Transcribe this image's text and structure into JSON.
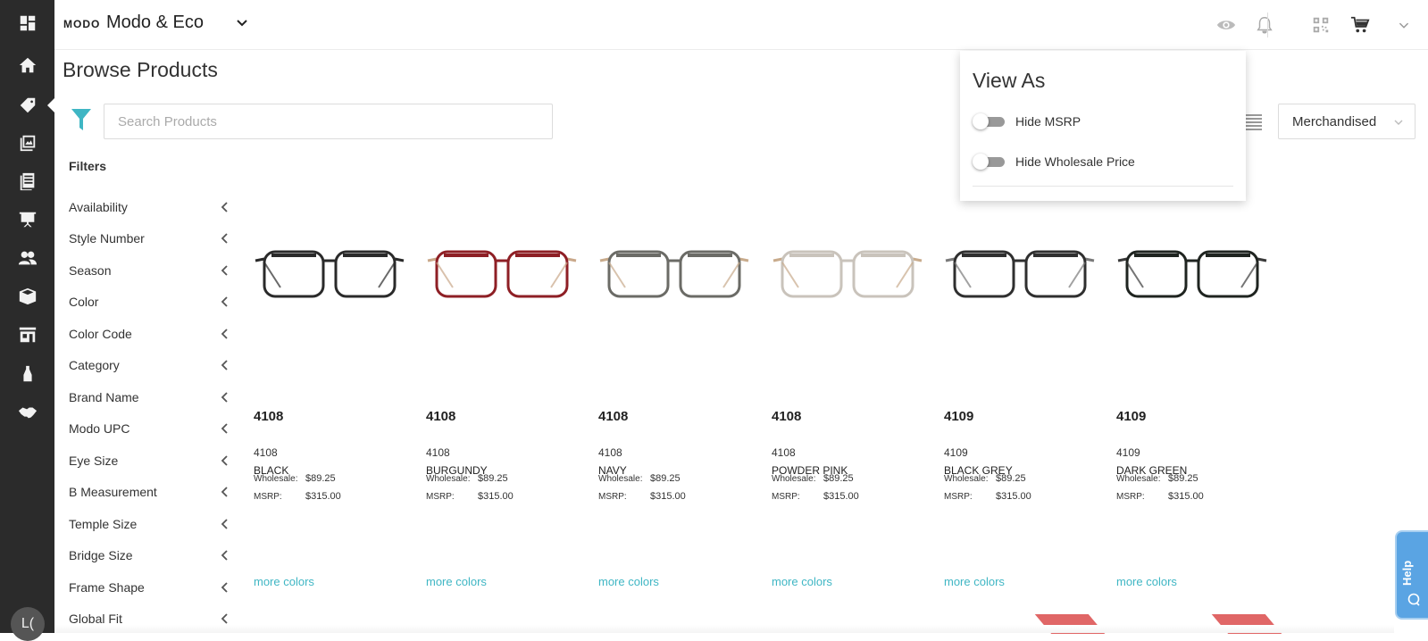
{
  "rail": {
    "icons": [
      "dashboard-icon",
      "home-icon",
      "tag-icon",
      "gallery-icon",
      "catalog-icon",
      "presentation-icon",
      "users-icon",
      "box-icon",
      "store-icon",
      "bottle-icon",
      "handshake-icon"
    ],
    "avatar_text": "L("
  },
  "header": {
    "logo": "MODO",
    "brand": "Modo & Eco",
    "icons": [
      "eye-icon",
      "bell-icon",
      "qr-icon",
      "cart-icon",
      "chevron-down-icon"
    ]
  },
  "page": {
    "title": "Browse Products",
    "search_placeholder": "Search Products",
    "filters_title": "Filters",
    "filters": [
      "Availability",
      "Style Number",
      "Season",
      "Color",
      "Color Code",
      "Category",
      "Brand Name",
      "Modo UPC",
      "Eye Size",
      "B Measurement",
      "Temple Size",
      "Bridge Size",
      "Frame Shape",
      "Global Fit"
    ],
    "sort_value": "Merchandised"
  },
  "view_as": {
    "title": "View As",
    "hide_msrp_label": "Hide MSRP",
    "hide_msrp": false,
    "hide_wholesale_label": "Hide Wholesale Price",
    "hide_wholesale": false
  },
  "products": [
    {
      "style": "4108",
      "sub": "4108",
      "color": "BLACK",
      "wholesale_label": "Wholesale:",
      "wholesale": "$89.25",
      "msrp_label": "MSRP:",
      "msrp": "$315.00",
      "more": "more colors",
      "frame_color": "#2a2a2a",
      "temple_color": "#2a2a2a"
    },
    {
      "style": "4108",
      "sub": "4108",
      "color": "BURGUNDY",
      "wholesale_label": "Wholesale:",
      "wholesale": "$89.25",
      "msrp_label": "MSRP:",
      "msrp": "$315.00",
      "more": "more colors",
      "frame_color": "#8e1f25",
      "temple_color": "#c9a88a"
    },
    {
      "style": "4108",
      "sub": "4108",
      "color": "NAVY",
      "wholesale_label": "Wholesale:",
      "wholesale": "$89.25",
      "msrp_label": "MSRP:",
      "msrp": "$315.00",
      "more": "more colors",
      "frame_color": "#6b6b66",
      "temple_color": "#c8ab8c"
    },
    {
      "style": "4108",
      "sub": "4108",
      "color": "POWDER PINK",
      "wholesale_label": "Wholesale:",
      "wholesale": "$89.25",
      "msrp_label": "MSRP:",
      "msrp": "$315.00",
      "more": "more colors",
      "frame_color": "#c9c3bb",
      "temple_color": "#c8ab8c"
    },
    {
      "style": "4109",
      "sub": "4109",
      "color": "BLACK GREY",
      "wholesale_label": "Wholesale:",
      "wholesale": "$89.25",
      "msrp_label": "MSRP:",
      "msrp": "$315.00",
      "more": "more colors",
      "frame_color": "#2f2f2f",
      "temple_color": "#7a7a7a"
    },
    {
      "style": "4109",
      "sub": "4109",
      "color": "DARK GREEN",
      "wholesale_label": "Wholesale:",
      "wholesale": "$89.25",
      "msrp_label": "MSRP:",
      "msrp": "$315.00",
      "more": "more colors",
      "frame_color": "#1f2420",
      "temple_color": "#3a3a3a"
    }
  ],
  "help": {
    "label": "Help"
  },
  "colors": {
    "accent": "#3fb6c4",
    "rail": "#2b2b2b",
    "help": "#5aa4e3",
    "ribbon": "#e06666"
  }
}
